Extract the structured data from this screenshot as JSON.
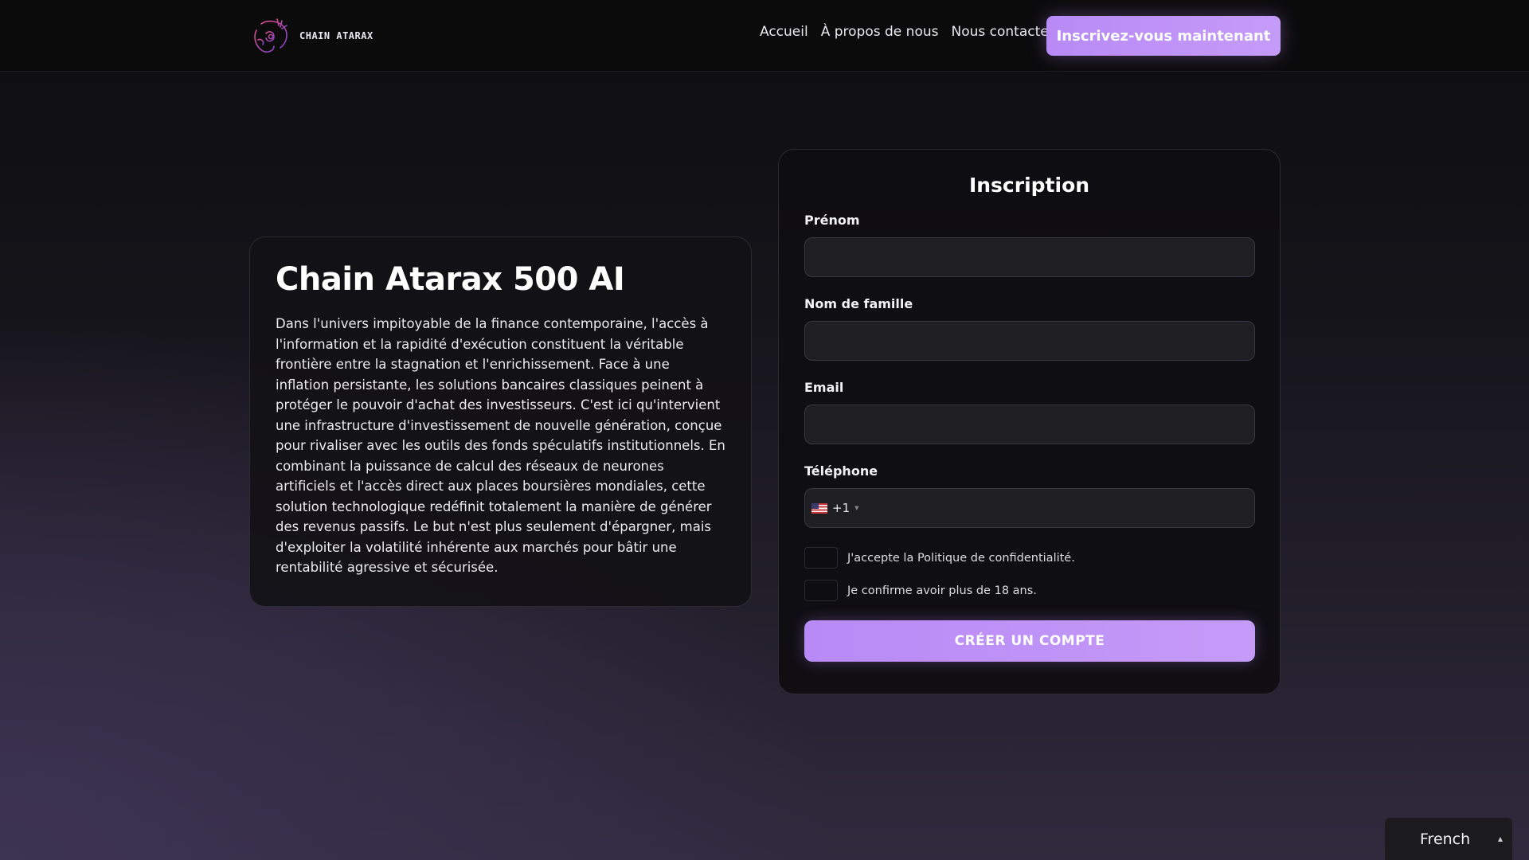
{
  "header": {
    "logo_text": "CHAIN ATARAX",
    "nav": [
      "Accueil",
      "À propos de nous",
      "Nous contacter"
    ],
    "cta_label": "Inscrivez-vous maintenant"
  },
  "info": {
    "title": "Chain Atarax 500 AI",
    "text": "Dans l'univers impitoyable de la finance contemporaine, l'accès à l'information et la rapidité d'exécution constituent la véritable frontière entre la stagnation et l'enrichissement. Face à une inflation persistante, les solutions bancaires classiques peinent à protéger le pouvoir d'achat des investisseurs. C'est ici qu'intervient une infrastructure d'investissement de nouvelle génération, conçue pour rivaliser avec les outils des fonds spéculatifs institutionnels. En combinant la puissance de calcul des réseaux de neurones artificiels et l'accès direct aux places boursières mondiales, cette solution technologique redéfinit totalement la manière de générer des revenus passifs. Le but n'est plus seulement d'épargner, mais d'exploiter la volatilité inhérente aux marchés pour bâtir une rentabilité agressive et sécurisée."
  },
  "form": {
    "title": "Inscription",
    "first_name_label": "Prénom",
    "first_name_value": "",
    "last_name_label": "Nom de famille",
    "last_name_value": "",
    "email_label": "Email",
    "email_value": "",
    "phone_label": "Téléphone",
    "phone_dial_code": "+1",
    "phone_country_flag": "us-flag-icon",
    "phone_value": "",
    "privacy_label": "J'accepte la Politique de confidentialité.",
    "privacy_checked": false,
    "age_label": "Je confirme avoir plus de 18 ans.",
    "age_checked": false,
    "submit_label": "CRÉER UN COMPTE"
  },
  "language": {
    "selected": "French"
  },
  "colors": {
    "accent": "#b78af6",
    "accent_light": "#c59bf8",
    "header_bg": "#0b0b0c",
    "card_bg": "#121116",
    "input_bg": "#1f1e23"
  }
}
